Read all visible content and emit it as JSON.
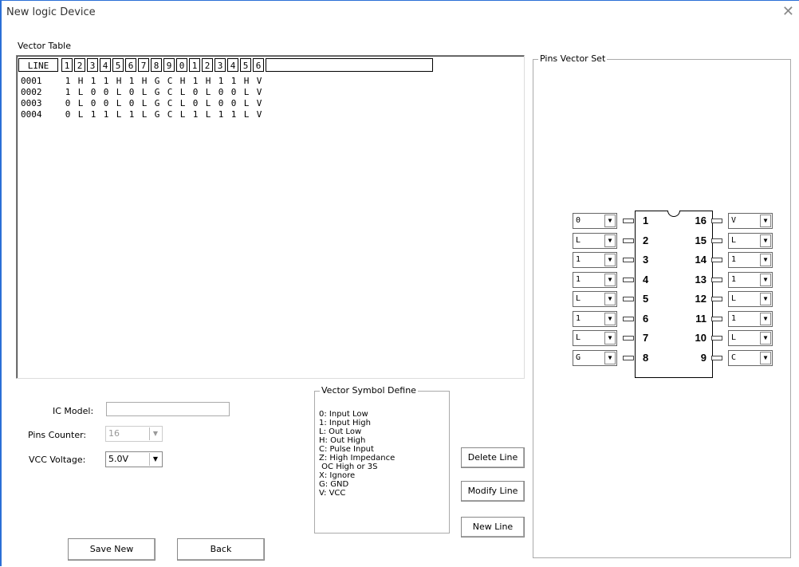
{
  "window": {
    "title": "New logic Device",
    "close_glyph": "✕"
  },
  "vector_table": {
    "label": "Vector Table",
    "header": [
      "LINE",
      "1",
      "2",
      "3",
      "4",
      "5",
      "6",
      "7",
      "8",
      "9",
      "0",
      "1",
      "2",
      "3",
      "4",
      "5",
      "6"
    ],
    "rows": [
      {
        "line": "0001",
        "pins": [
          "1",
          "H",
          "1",
          "1",
          "H",
          "1",
          "H",
          "G",
          "C",
          "H",
          "1",
          "H",
          "1",
          "1",
          "H",
          "V"
        ]
      },
      {
        "line": "0002",
        "pins": [
          "1",
          "L",
          "0",
          "0",
          "L",
          "0",
          "L",
          "G",
          "C",
          "L",
          "0",
          "L",
          "0",
          "0",
          "L",
          "V"
        ]
      },
      {
        "line": "0003",
        "pins": [
          "0",
          "L",
          "0",
          "0",
          "L",
          "0",
          "L",
          "G",
          "C",
          "L",
          "0",
          "L",
          "0",
          "0",
          "L",
          "V"
        ]
      },
      {
        "line": "0004",
        "pins": [
          "0",
          "L",
          "1",
          "1",
          "L",
          "1",
          "L",
          "G",
          "C",
          "L",
          "1",
          "L",
          "1",
          "1",
          "L",
          "V"
        ]
      }
    ]
  },
  "form": {
    "ic_model_label": "IC Model:",
    "ic_model_value": "",
    "pins_counter_label": "Pins Counter:",
    "pins_counter_value": "16",
    "vcc_voltage_label": "VCC Voltage:",
    "vcc_voltage_value": "5.0V"
  },
  "symbol_define": {
    "title": "Vector Symbol Define",
    "lines": [
      "0: Input Low",
      "1: Input High",
      "L: Out Low",
      "H: Out High",
      "C: Pulse Input",
      "Z: High Impedance",
      " OC High or 3S",
      "X: Ignore",
      "G: GND",
      "V: VCC"
    ]
  },
  "buttons": {
    "delete_line": "Delete Line",
    "modify_line": "Modify Line",
    "new_line": "New Line",
    "save_new": "Save New",
    "back": "Back"
  },
  "pins_vector_set": {
    "title": "Pins Vector Set",
    "left": [
      {
        "num": "1",
        "value": "0"
      },
      {
        "num": "2",
        "value": "L"
      },
      {
        "num": "3",
        "value": "1"
      },
      {
        "num": "4",
        "value": "1"
      },
      {
        "num": "5",
        "value": "L"
      },
      {
        "num": "6",
        "value": "1"
      },
      {
        "num": "7",
        "value": "L"
      },
      {
        "num": "8",
        "value": "G"
      }
    ],
    "right": [
      {
        "num": "16",
        "value": "V"
      },
      {
        "num": "15",
        "value": "L"
      },
      {
        "num": "14",
        "value": "1"
      },
      {
        "num": "13",
        "value": "1"
      },
      {
        "num": "12",
        "value": "L"
      },
      {
        "num": "11",
        "value": "1"
      },
      {
        "num": "10",
        "value": "L"
      },
      {
        "num": "9",
        "value": "C"
      }
    ]
  },
  "icons": {
    "dropdown": "chevron-down-icon",
    "close": "close-icon"
  }
}
